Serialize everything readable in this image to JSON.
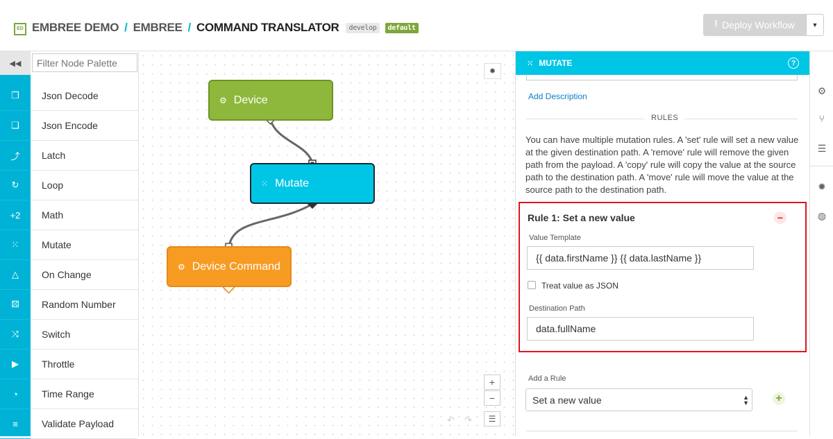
{
  "header": {
    "logo_text": "ED",
    "breadcrumb": [
      "EMBREE DEMO",
      "EMBREE",
      "COMMAND TRANSLATOR"
    ],
    "separator": "/",
    "badge_branch": "develop",
    "badge_default": "default",
    "deploy_label": "Deploy Workflow",
    "deploy_icon": "upload-icon",
    "caret_icon": "caret-down-icon"
  },
  "palette": {
    "collapse_icon": "double-chevron-left-icon",
    "filter_placeholder": "Filter Node Palette",
    "items": [
      {
        "label": "Json Decode",
        "icon": "json-decode-icon",
        "glyph": "❐"
      },
      {
        "label": "Json Encode",
        "icon": "json-encode-icon",
        "glyph": "❑"
      },
      {
        "label": "Latch",
        "icon": "latch-icon",
        "glyph": "⤴"
      },
      {
        "label": "Loop",
        "icon": "loop-icon",
        "glyph": "↻"
      },
      {
        "label": "Math",
        "icon": "math-icon",
        "glyph": "+2"
      },
      {
        "label": "Mutate",
        "icon": "mutate-icon",
        "glyph": "⁙"
      },
      {
        "label": "On Change",
        "icon": "on-change-icon",
        "glyph": "△"
      },
      {
        "label": "Random Number",
        "icon": "random-number-icon",
        "glyph": "⚄"
      },
      {
        "label": "Switch",
        "icon": "switch-icon",
        "glyph": "⤨"
      },
      {
        "label": "Throttle",
        "icon": "throttle-icon",
        "glyph": "▶"
      },
      {
        "label": "Time Range",
        "icon": "time-range-icon",
        "glyph": "◔"
      },
      {
        "label": "Validate Payload",
        "icon": "validate-payload-icon",
        "glyph": "≡"
      }
    ]
  },
  "canvas": {
    "nodes": {
      "device": "Device",
      "mutate": "Mutate",
      "command": "Device Command"
    },
    "debug_icon": "bug-icon",
    "zoom_in": "+",
    "zoom_out": "−",
    "menu_icon": "menu-icon"
  },
  "panel": {
    "title": "MUTATE",
    "add_description": "Add Description",
    "rules_heading": "RULES",
    "rules_text": "You can have multiple mutation rules. A 'set' rule will set a new value at the given destination path. A 'remove' rule will remove the given path from the payload. A 'copy' rule will copy the value at the source path to the destination path. A 'move' rule will move the value at the source path to the destination path.",
    "rule": {
      "title": "Rule 1: Set a new value",
      "value_template_label": "Value Template",
      "value_template": "{{ data.firstName }} {{ data.lastName }}",
      "treat_json_label": "Treat value as JSON",
      "treat_json": false,
      "destination_label": "Destination Path",
      "destination": "data.fullName"
    },
    "add_rule_label": "Add a Rule",
    "add_rule_selected": "Set a new value"
  },
  "rail": [
    "gear-icon",
    "branch-icon",
    "database-icon",
    "bug-icon",
    "globe-icon"
  ],
  "colors": {
    "accent_cyan": "#00b3d6",
    "device_green": "#8eb83b",
    "mutate_cyan": "#00c6e6",
    "command_orange": "#f89b23",
    "highlight_red": "#e0141e"
  }
}
